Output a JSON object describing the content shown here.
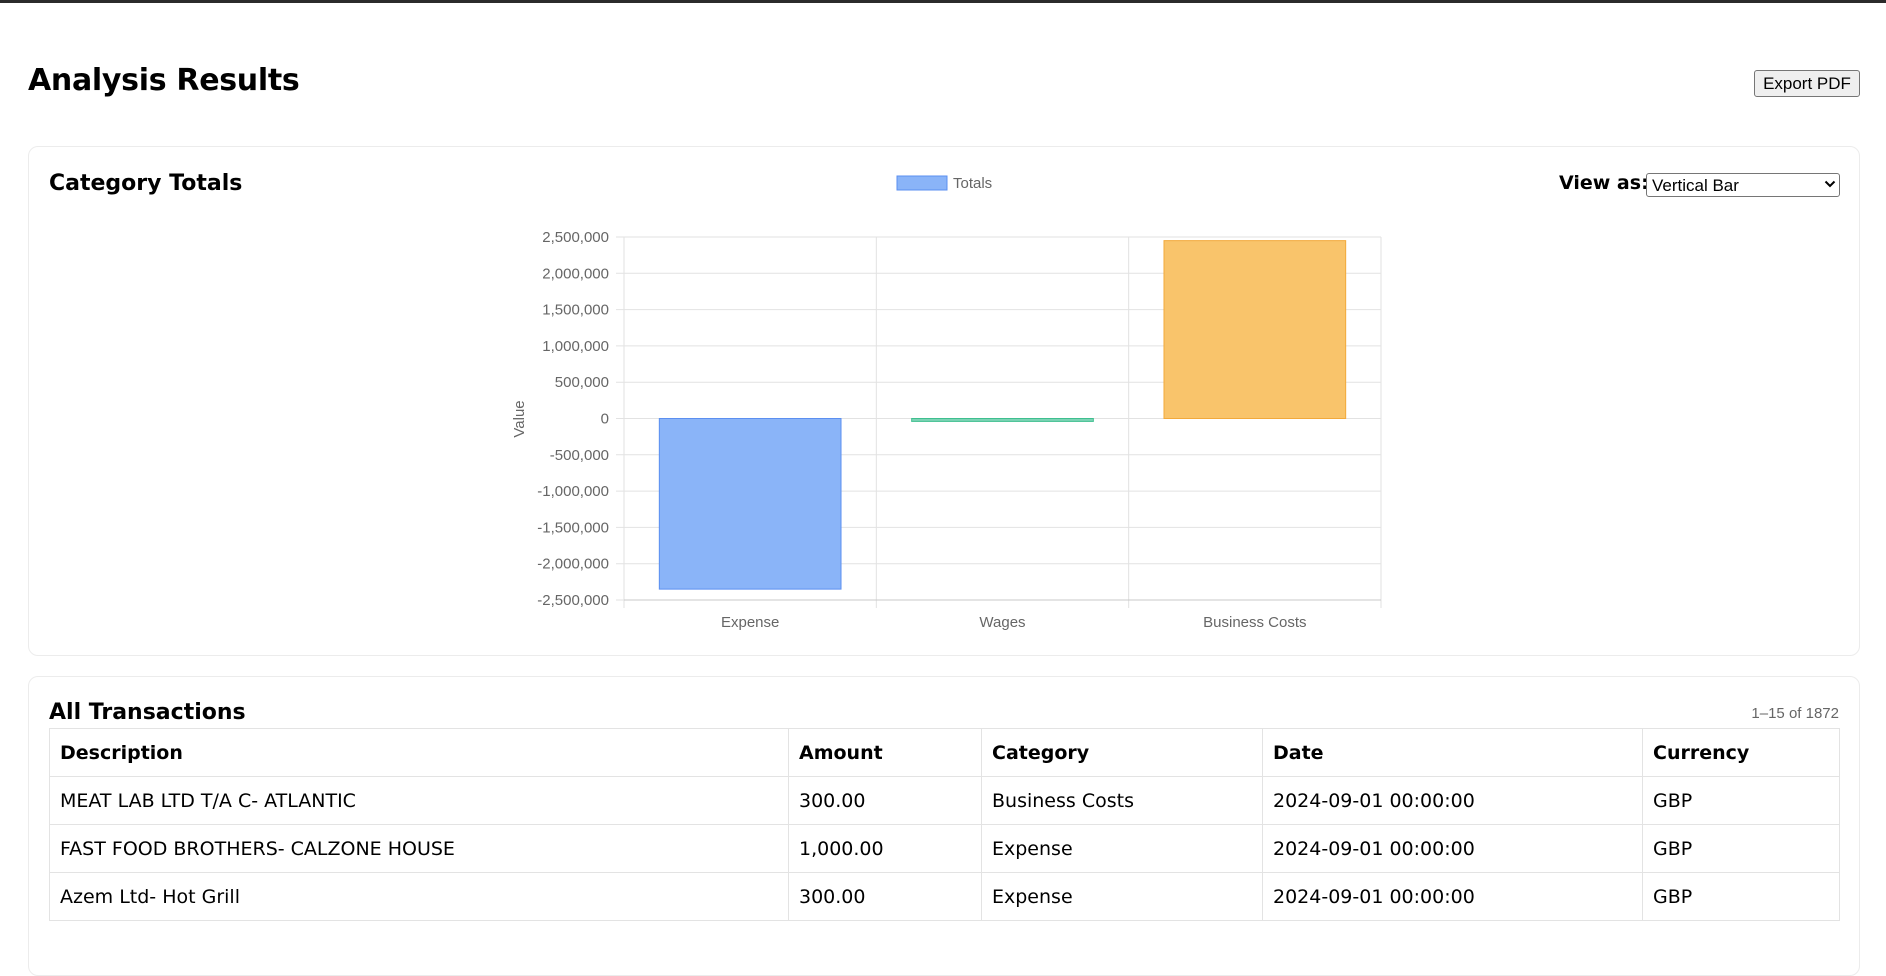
{
  "page": {
    "title": "Analysis Results",
    "export_label": "Export PDF"
  },
  "chart_section": {
    "title": "Category Totals",
    "view_label": "View as:",
    "view_selected": "Vertical Bar"
  },
  "chart_data": {
    "type": "bar",
    "categories": [
      "Expense",
      "Wages",
      "Business Costs"
    ],
    "series": [
      {
        "name": "Totals",
        "values": [
          -2350000,
          -40000,
          2450000
        ],
        "colors": [
          "#8ab4f8",
          "#7dd3b5",
          "#f9c46b"
        ],
        "border_colors": [
          "#5b8ff0",
          "#3fbf8f",
          "#f2a93b"
        ]
      }
    ],
    "ylabel": "Value",
    "xlabel": "",
    "ylim": [
      -2500000,
      2500000
    ],
    "yticks": [
      "2,500,000",
      "2,000,000",
      "1,500,000",
      "1,000,000",
      "500,000",
      "0",
      "-500,000",
      "-1,000,000",
      "-1,500,000",
      "-2,000,000",
      "-2,500,000"
    ],
    "legend_position": "top",
    "grid": true
  },
  "transactions": {
    "title": "All Transactions",
    "count_text": "1–15 of 1872",
    "columns": [
      "Description",
      "Amount",
      "Category",
      "Date",
      "Currency"
    ],
    "rows": [
      [
        "MEAT LAB LTD T/A C- ATLANTIC",
        "300.00",
        "Business Costs",
        "2024-09-01 00:00:00",
        "GBP"
      ],
      [
        "FAST FOOD BROTHERS- CALZONE HOUSE",
        "1,000.00",
        "Expense",
        "2024-09-01 00:00:00",
        "GBP"
      ],
      [
        "Azem Ltd- Hot Grill",
        "300.00",
        "Expense",
        "2024-09-01 00:00:00",
        "GBP"
      ]
    ]
  }
}
